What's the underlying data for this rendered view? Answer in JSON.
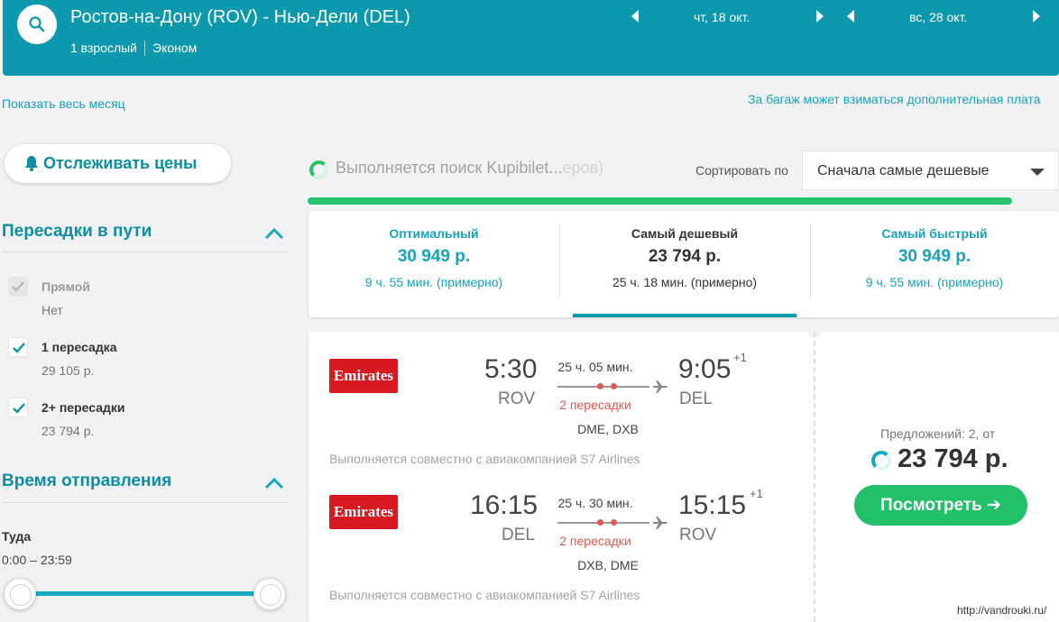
{
  "header": {
    "route": "Ростов-на-Дону (ROV) - Нью-Дели (DEL)",
    "passengers": "1 взрослый",
    "cabin": "Эконом",
    "depart_date": "чт, 18 окт.",
    "return_date": "вс, 28 окт.",
    "accent_color": "#0c99ad"
  },
  "links": {
    "show_month": "Показать весь месяц",
    "baggage_note": "За багаж может взиматься дополнительная плата"
  },
  "sidebar": {
    "track_prices": "Отслеживать цены",
    "stops_title": "Пересадки в пути",
    "stops_options": [
      {
        "label": "Прямой",
        "sub": "Нет",
        "checked": true,
        "disabled": true
      },
      {
        "label": "1 пересадка",
        "sub": "29 105 р.",
        "checked": true,
        "disabled": false
      },
      {
        "label": "2+ пересадки",
        "sub": "23 794 р.",
        "checked": true,
        "disabled": false
      }
    ],
    "departure_title": "Время отправления",
    "direction": "Туда",
    "time_range": "0:00 – 23:59",
    "slider_range": [
      0,
      1
    ]
  },
  "search": {
    "status": "Выполняется поиск Kupibilet...",
    "status_faded": "еров)",
    "sort_label": "Сортировать по",
    "sort_value": "Сначала самые дешевые",
    "progress": 0.94
  },
  "tabs": [
    {
      "title": "Оптимальный",
      "price": "30 949 р.",
      "duration": "9 ч. 55 мин. (примерно)"
    },
    {
      "title": "Самый дешевый",
      "price": "23 794 р.",
      "duration": "25 ч. 18 мин. (примерно)",
      "active": true
    },
    {
      "title": "Самый быстрый",
      "price": "30 949 р.",
      "duration": "9 ч. 55 мин. (примерно)"
    }
  ],
  "result": {
    "legs": [
      {
        "airline": "Emirates",
        "dep_time": "5:30",
        "dep_code": "ROV",
        "duration": "25 ч. 05 мин.",
        "stops": "2 пересадки",
        "via": "DME, DXB",
        "arr_time": "9:05",
        "arr_plus": "+1",
        "arr_code": "DEL",
        "operated": "Выполняется совместно с авиакомпанией S7 Airlines"
      },
      {
        "airline": "Emirates",
        "dep_time": "16:15",
        "dep_code": "DEL",
        "duration": "25 ч. 30 мин.",
        "stops": "2 пересадки",
        "via": "DXB, DME",
        "arr_time": "15:15",
        "arr_plus": "+1",
        "arr_code": "ROV",
        "operated": "Выполняется совместно с авиакомпанией S7 Airlines"
      }
    ],
    "offers": "Предложений: 2, от",
    "price": "23 794 р.",
    "view_button": "Посмотреть ➔"
  },
  "watermark": "http://vandrouki.ru/"
}
